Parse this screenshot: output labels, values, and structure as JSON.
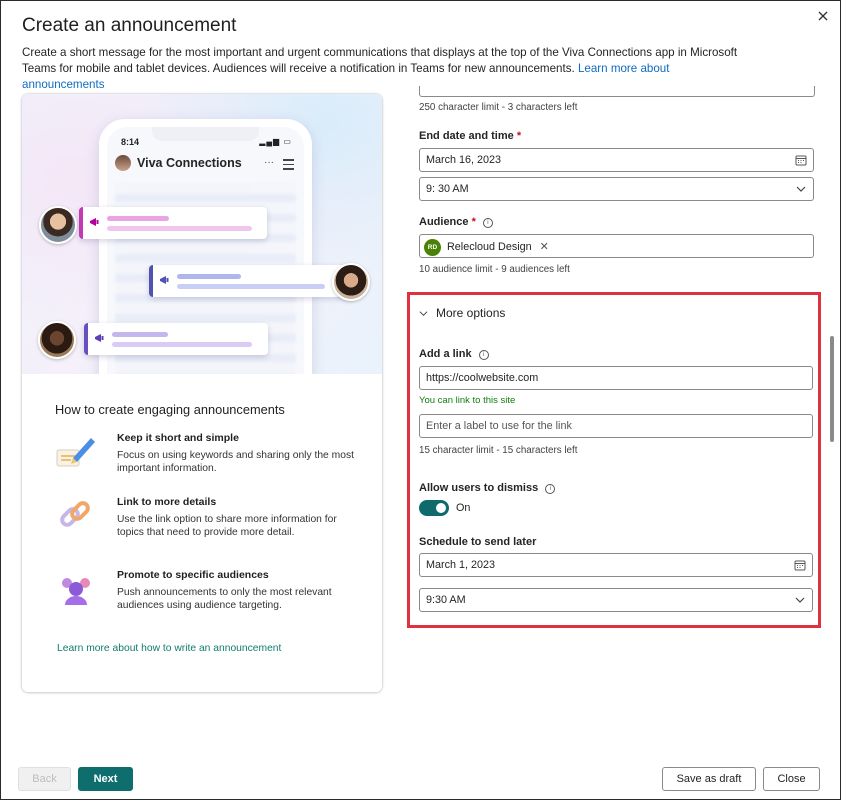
{
  "dialog": {
    "title": "Create an announcement",
    "description": "Create a short message for the most important and urgent communications that displays at the top of the Viva Connections app in Microsoft Teams for mobile and tablet devices. Audiences will receive a notification in Teams for new announcements.",
    "learn_more_link": "Learn more about announcements"
  },
  "preview": {
    "phone_time": "8:14",
    "phone_status": "▂▄▆ ▭",
    "app_name": "Viva Connections",
    "more_glyph": "···"
  },
  "tips": {
    "heading": "How to create engaging announcements",
    "items": [
      {
        "title": "Keep it short and simple",
        "body": "Focus on using keywords and sharing only the most important information."
      },
      {
        "title": "Link to more details",
        "body": "Use the link option to share more information for topics that need to provide more detail."
      },
      {
        "title": "Promote to specific audiences",
        "body": "Push announcements to only the most relevant audiences using audience targeting."
      }
    ],
    "learn_link": "Learn more about how to write an announcement"
  },
  "form": {
    "message_limit_hint": "250 character limit - 3 characters left",
    "end_date_label": "End date and time",
    "end_date_value": "March 16, 2023",
    "end_time_value": "9: 30 AM",
    "audience_label": "Audience",
    "audience_chip_initials": "RD",
    "audience_chip_name": "Relecloud Design",
    "audience_hint": "10 audience limit - 9 audiences left",
    "more_options_label": "More options",
    "link_label": "Add a link",
    "link_value": "https://coolwebsite.com",
    "link_ok_hint": "You can link to this site",
    "link_label_placeholder": "Enter a label to use for the link",
    "link_label_hint": "15 character limit - 15 characters left",
    "dismiss_label": "Allow users to dismiss",
    "dismiss_state": "On",
    "schedule_label": "Schedule to send later",
    "schedule_date_value": "March 1, 2023",
    "schedule_time_value": "9:30 AM",
    "required_mark": "*"
  },
  "footer": {
    "back_label": "Back",
    "next_label": "Next",
    "save_draft_label": "Save as draft",
    "close_label": "Close"
  },
  "colors": {
    "accent": "#0e6e6e",
    "highlight_border": "#e0323e",
    "link_teal": "#107c6f",
    "link_blue": "#0f6cbd"
  }
}
